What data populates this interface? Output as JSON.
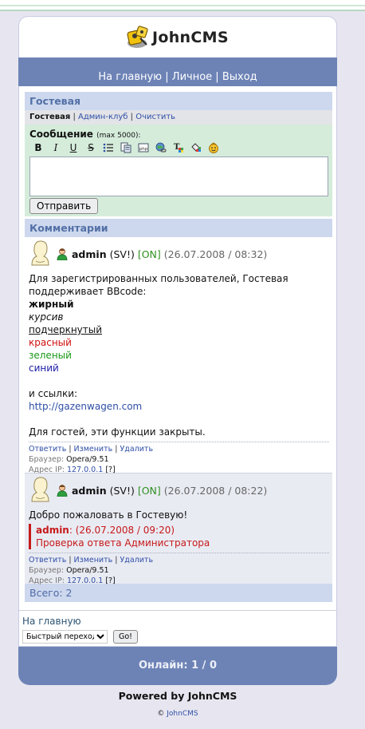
{
  "app": {
    "name": "JohnCMS"
  },
  "nav": {
    "home": "На главную",
    "personal": "Личное",
    "logout": "Выход",
    "sep": "|"
  },
  "guestbook": {
    "title": "Гостевая",
    "menu": {
      "current": "Гостевая",
      "admin_club": "Админ-клуб",
      "clear": "Очистить"
    },
    "form": {
      "label": "Сообщение",
      "limit": "(max 5000):",
      "toolbar": {
        "bold": "B",
        "italic": "I",
        "underline": "U",
        "strike": "S"
      },
      "textarea_value": "",
      "submit_label": "Отправить"
    }
  },
  "comments": {
    "title": "Комментарии",
    "posts": [
      {
        "user": "admin",
        "role": "(SV!)",
        "status": "[ON]",
        "time": "(26.07.2008 / 08:32)",
        "lines": {
          "l1": "Для зарегистрированных пользователей, Гостевая поддерживает BBcode:",
          "bold": "жирный",
          "italic": "курсив",
          "underline": "подчеркнутый",
          "red": "красный",
          "green": "зеленый",
          "blue": "синий",
          "links_label": "и ссылки:",
          "link": "http://gazenwagen.com",
          "guests": "Для гостей, эти функции закрыты."
        },
        "actions": {
          "reply": "Ответить",
          "edit": "Изменить",
          "delete": "Удалить"
        },
        "browser_label": "Браузер:",
        "browser": "Opera/9.51",
        "ip_label": "Адрес IP:",
        "ip": "127.0.0.1",
        "ip_extra": "[?]"
      },
      {
        "user": "admin",
        "role": "(SV!)",
        "status": "[ON]",
        "time": "(26.07.2008 / 08:22)",
        "text": "Добро пожаловать в Гостевую!",
        "reply": {
          "name": "admin",
          "time": ": (26.07.2008 / 09:20)",
          "text": "Проверка ответа Администратора"
        },
        "actions": {
          "reply": "Ответить",
          "edit": "Изменить",
          "delete": "Удалить"
        },
        "browser_label": "Браузер:",
        "browser": "Opera/9.51",
        "ip_label": "Адрес IP:",
        "ip": "127.0.0.1",
        "ip_extra": "[?]"
      }
    ],
    "total": "Всего: 2"
  },
  "footer_nav": {
    "home": "На главную",
    "quick_jump": "Быстрый переход",
    "go": "Go!"
  },
  "online": "Онлайн: 1 / 0",
  "powered": "Powered by JohnCMS",
  "copyright": {
    "symbol": "©",
    "link": "JohnCMS"
  },
  "colors": {
    "accent": "#6d83b6",
    "section_header": "#cdd8ee",
    "form_bg": "#d5ecdb",
    "online_green": "#2f8f21",
    "reply_red": "#c61a1a"
  }
}
